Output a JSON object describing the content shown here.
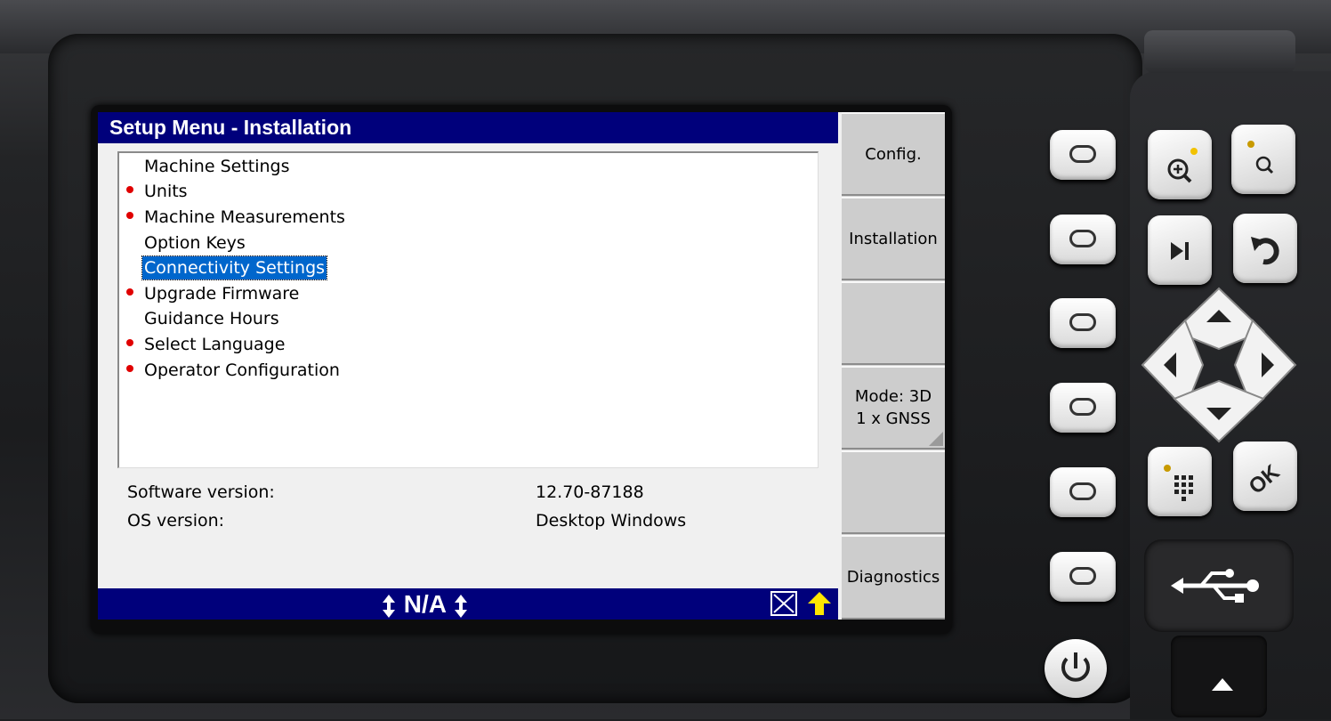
{
  "window": {
    "title": "Setup Menu - Installation"
  },
  "menu_items": [
    {
      "label": "Machine Settings",
      "alert": false,
      "selected": false
    },
    {
      "label": "Units",
      "alert": true,
      "selected": false
    },
    {
      "label": "Machine Measurements",
      "alert": true,
      "selected": false
    },
    {
      "label": "Option Keys",
      "alert": false,
      "selected": false
    },
    {
      "label": "Connectivity Settings",
      "alert": false,
      "selected": true
    },
    {
      "label": "Upgrade Firmware",
      "alert": true,
      "selected": false
    },
    {
      "label": "Guidance Hours",
      "alert": false,
      "selected": false
    },
    {
      "label": "Select Language",
      "alert": true,
      "selected": false
    },
    {
      "label": "Operator Configuration",
      "alert": true,
      "selected": false
    }
  ],
  "info": {
    "software_label": "Software version:",
    "software_value": "12.70-87188",
    "os_label": "OS version:",
    "os_value": "Desktop Windows"
  },
  "sidebar": {
    "buttons": [
      "Config.",
      "Installation",
      "",
      "Mode: 3D\n1 x GNSS",
      "",
      "Diagnostics"
    ]
  },
  "status": {
    "text": "N/A"
  },
  "colors": {
    "title_bar": "#00007b",
    "selection": "#0066cc",
    "alert_dot": "#e00000",
    "warn_arrow": "#ffe600"
  },
  "hardware": {
    "softkey_icon": "o-softkey-icon",
    "keys": [
      "zoom-in-icon",
      "search-icon",
      "skip-icon",
      "undo-icon",
      "up-arrow-icon",
      "left-arrow-icon",
      "right-arrow-icon",
      "down-arrow-icon",
      "keypad-icon",
      "ok-icon",
      "usb-icon",
      "power-icon",
      "eject-arrow-icon"
    ],
    "ok_label": "OK"
  }
}
